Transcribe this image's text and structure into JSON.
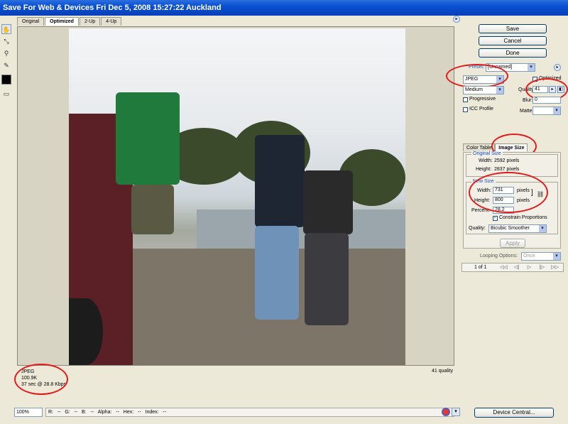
{
  "window": {
    "title": "Save For Web & Devices   Fri Dec 5, 2008   15:27:22 Auckland"
  },
  "tabs": [
    "Original",
    "Optimized",
    "2-Up",
    "4-Up"
  ],
  "tools": {
    "hand": "hand-icon",
    "slice_select": "slice-select-icon",
    "zoom": "zoom-icon",
    "eyedropper": "eyedropper-icon",
    "eyedropper_color": "#000000",
    "toggle_slices": "slices-visibility-icon"
  },
  "preview": {
    "format": "JPEG",
    "size": "100.9K",
    "time": "37 sec @ 28.8 Kbps",
    "quality_label": "41 quality"
  },
  "status": {
    "zoom": "100%",
    "readout": "R:   --   G:   --   B:   --   Alpha:   --   Hex:   --   Index:   --"
  },
  "buttons": {
    "save": "Save",
    "cancel": "Cancel",
    "done": "Done",
    "device_central": "Device Central...",
    "apply": "Apply"
  },
  "settings": {
    "preset_label": "Preset:",
    "preset_value": "[Unnamed]",
    "format": "JPEG",
    "optimized": "Optimized",
    "compression": "Medium",
    "quality_label": "Quality:",
    "quality_value": "41",
    "progressive": "Progressive",
    "blur_label": "Blur:",
    "blur_value": "0",
    "icc_profile": "ICC Profile",
    "matte_label": "Matte:"
  },
  "size_tabs": {
    "color_table": "Color Table",
    "image_size": "Image Size"
  },
  "image_size": {
    "original_title": "Original Size",
    "orig_width_label": "Width:",
    "orig_width": "2592 pixels",
    "orig_height_label": "Height:",
    "orig_height": "2837 pixels",
    "new_title": "New Size",
    "width_label": "Width:",
    "width_value": "731",
    "width_unit": "pixels",
    "height_label": "Height:",
    "height_value": "800",
    "height_unit": "pixels",
    "percent_label": "Percent:",
    "percent_value": "28.2",
    "constrain": "Constrain Proportions",
    "quality_label": "Quality:",
    "quality_value": "Bicubic Smoother"
  },
  "animation": {
    "looping_label": "Looping Options:",
    "looping_value": "Once",
    "frame_count": "1 of 1"
  }
}
